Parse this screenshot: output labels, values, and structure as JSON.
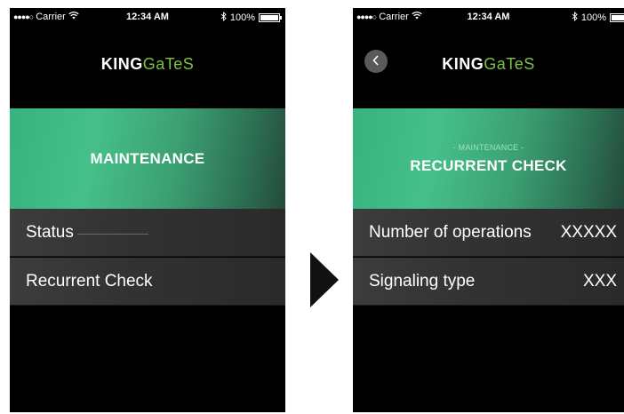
{
  "screens": [
    {
      "status_bar": {
        "carrier": "Carrier",
        "time": "12:34 AM",
        "battery": "100%"
      },
      "logo": {
        "king": "KING",
        "gates": "GaTeS"
      },
      "banner": {
        "subtitle": "",
        "title": "MAINTENANCE"
      },
      "rows": [
        {
          "label": "Status",
          "value": ""
        },
        {
          "label": "Recurrent Check",
          "value": ""
        }
      ]
    },
    {
      "status_bar": {
        "carrier": "Carrier",
        "time": "12:34 AM",
        "battery": "100%"
      },
      "logo": {
        "king": "KING",
        "gates": "GaTeS"
      },
      "banner": {
        "subtitle": "- MAINTENANCE -",
        "title": "RECURRENT CHECK"
      },
      "rows": [
        {
          "label": "Number of operations",
          "value": "XXXXX"
        },
        {
          "label": "Signaling type",
          "value": "XXX"
        }
      ]
    }
  ],
  "colors": {
    "accent_green": "#7dc242",
    "banner_green": "#46c08a",
    "row_bg": "#333333"
  },
  "icons": {
    "signal": "signal-dots-icon",
    "wifi": "wifi-icon",
    "bluetooth": "bluetooth-icon",
    "battery": "battery-icon",
    "back": "chevron-left-icon",
    "transition": "play-arrow-icon"
  }
}
